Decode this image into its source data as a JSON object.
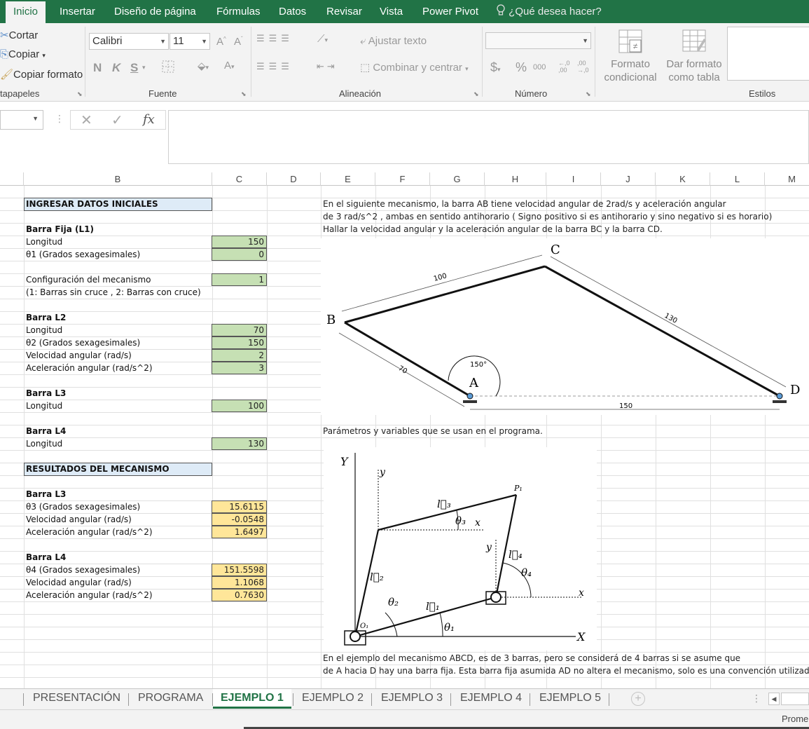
{
  "ribbon_tabs": [
    {
      "label": "Inicio",
      "active": true
    },
    {
      "label": "Insertar"
    },
    {
      "label": "Diseño de página"
    },
    {
      "label": "Fórmulas"
    },
    {
      "label": "Datos"
    },
    {
      "label": "Revisar"
    },
    {
      "label": "Vista"
    },
    {
      "label": "Power Pivot"
    }
  ],
  "tell_me": "¿Qué desea hacer?",
  "clipboard": {
    "cut": "Cortar",
    "copy": "Copiar",
    "format_painter": "Copiar formato",
    "group": "tapapeles"
  },
  "font": {
    "name": "Calibri",
    "size": "11",
    "bold": "N",
    "italic": "K",
    "underline": "S",
    "group": "Fuente"
  },
  "alignment": {
    "wrap": "Ajustar texto",
    "merge": "Combinar y centrar",
    "group": "Alineación"
  },
  "number": {
    "format": "",
    "currency": "$",
    "percent": "%",
    "thousands": "000",
    "group": "Número"
  },
  "styles": {
    "conditional": "Formato\ncondicional",
    "as_table": "Dar formato\ncomo tabla",
    "group": "Estilos"
  },
  "formula_bar": {
    "fx": "fx",
    "name_box": "",
    "content": ""
  },
  "columns": [
    "B",
    "C",
    "D",
    "E",
    "F",
    "G",
    "H",
    "I",
    "J",
    "K",
    "L",
    "M"
  ],
  "sheet": {
    "input_header": "INGRESAR DATOS INICIALES",
    "l1_title": "Barra Fija (L1)",
    "l1_len_label": "Longitud",
    "l1_len": "150",
    "theta1_label": "θ1 (Grados sexagesimales)",
    "theta1": "0",
    "config_label": "Configuración del mecanismo",
    "config": "1",
    "config_note": "(1: Barras sin cruce , 2: Barras con cruce)",
    "l2_title": "Barra L2",
    "l2_len_label": "Longitud",
    "l2_len": "70",
    "theta2_label": "θ2 (Grados sexagesimales)",
    "theta2": "150",
    "w2_label": "Velocidad angular (rad/s)",
    "w2": "2",
    "a2_label": "Aceleración angular (rad/s^2)",
    "a2": "3",
    "l3_title": "Barra L3",
    "l3_len_label": "Longitud",
    "l3_len": "100",
    "l4_title": "Barra L4",
    "l4_len_label": "Longitud",
    "l4_len": "130",
    "results_header": "RESULTADOS DEL MECANISMO",
    "r3_title": "Barra L3",
    "theta3_label": "θ3 (Grados sexagesimales)",
    "theta3": "15.6115",
    "w3_label": "Velocidad angular (rad/s)",
    "w3": "-0.0548",
    "a3_label": "Aceleración angular (rad/s^2)",
    "a3": "1.6497",
    "r4_title": "Barra L4",
    "theta4_label": "θ4 (Grados sexagesimales)",
    "theta4": "151.5598",
    "w4_label": "Velocidad angular (rad/s)",
    "w4": "1.1068",
    "a4_label": "Aceleración angular (rad/s^2)",
    "a4": "0.7630",
    "problem_1": "En el siguiente mecanismo, la barra AB tiene velocidad angular de 2rad/s y aceleración angular",
    "problem_2": "de 3 rad/s^2 , ambas en sentido antihorario ( Signo positivo si es antihorario y sino negativo si es horario)",
    "problem_3": "Hallar la velocidad angular y la aceleración angular de la barra BC y la barra CD.",
    "params_text": "Parámetros y variables que se usan en el programa.",
    "note_1": "En el ejemplo del mecanismo ABCD, es de 3 barras, pero se considerá de 4 barras si se asume que",
    "note_2": "de A hacia D hay una barra fija. Esta barra fija asumida AD no altera el mecanismo, solo es una convención utilizada."
  },
  "diagram1": {
    "A": "A",
    "B": "B",
    "C": "C",
    "D": "D",
    "ab": "70",
    "bc": "100",
    "cd": "130",
    "ad": "150",
    "angle": "150°"
  },
  "diagram2": {
    "Y": "Y",
    "X": "X",
    "y": "y",
    "x": "x",
    "P1": "P₁",
    "O1": "O₁",
    "l1": "l⃗₁",
    "l2": "l⃗₂",
    "l3": "l⃗₃",
    "l4": "l⃗₄",
    "t1": "θ₁",
    "t2": "θ₂",
    "t3": "θ₃",
    "t4": "θ₄"
  },
  "sheet_tabs": [
    "PRESENTACIÓN",
    "PROGRAMA",
    "EJEMPLO 1",
    "EJEMPLO 2",
    "EJEMPLO 3",
    "EJEMPLO 4",
    "EJEMPLO 5"
  ],
  "active_sheet": "EJEMPLO 1",
  "status_right": "Prome",
  "colors": {
    "excel_green": "#217346",
    "input_fill": "#c6e0b4",
    "output_fill": "#ffe699",
    "header_fill": "#deebf7"
  }
}
